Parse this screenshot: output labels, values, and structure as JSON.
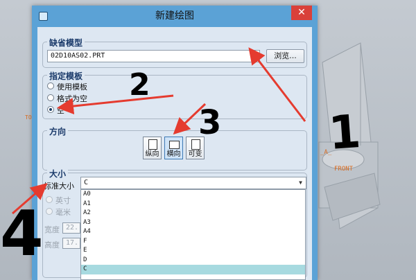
{
  "dialog": {
    "title": "新建绘图",
    "close_label": "✕"
  },
  "default_model": {
    "label": "缺省模型",
    "value": "02D10AS02.PRT",
    "browse_label": "浏览..."
  },
  "template": {
    "label": "指定模板",
    "options": [
      "使用模板",
      "格式为空",
      "空"
    ],
    "selected": "空"
  },
  "orientation": {
    "label": "方向",
    "buttons": [
      "纵向",
      "横向",
      "可变"
    ],
    "selected": "横向"
  },
  "size": {
    "label": "大小",
    "standard_label": "标准大小",
    "selected_value": "C",
    "list_items": [
      "A0",
      "A1",
      "A2",
      "A3",
      "A4",
      "F",
      "E",
      "D",
      "C"
    ],
    "units": [
      "英寸",
      "毫米"
    ],
    "width_label": "宽度",
    "width_value": "22.",
    "height_label": "高度",
    "height_value": "17."
  },
  "background": {
    "left_text": "TO",
    "part_label_a": "_A_",
    "part_label_front": "FRONT"
  },
  "annotations": [
    "1",
    "2",
    "3",
    "4"
  ],
  "colors": {
    "titlebar": "#5ba2d6",
    "close_button": "#d9403a",
    "arrow": "#e53b2f",
    "highlight": "#a7dae0"
  }
}
